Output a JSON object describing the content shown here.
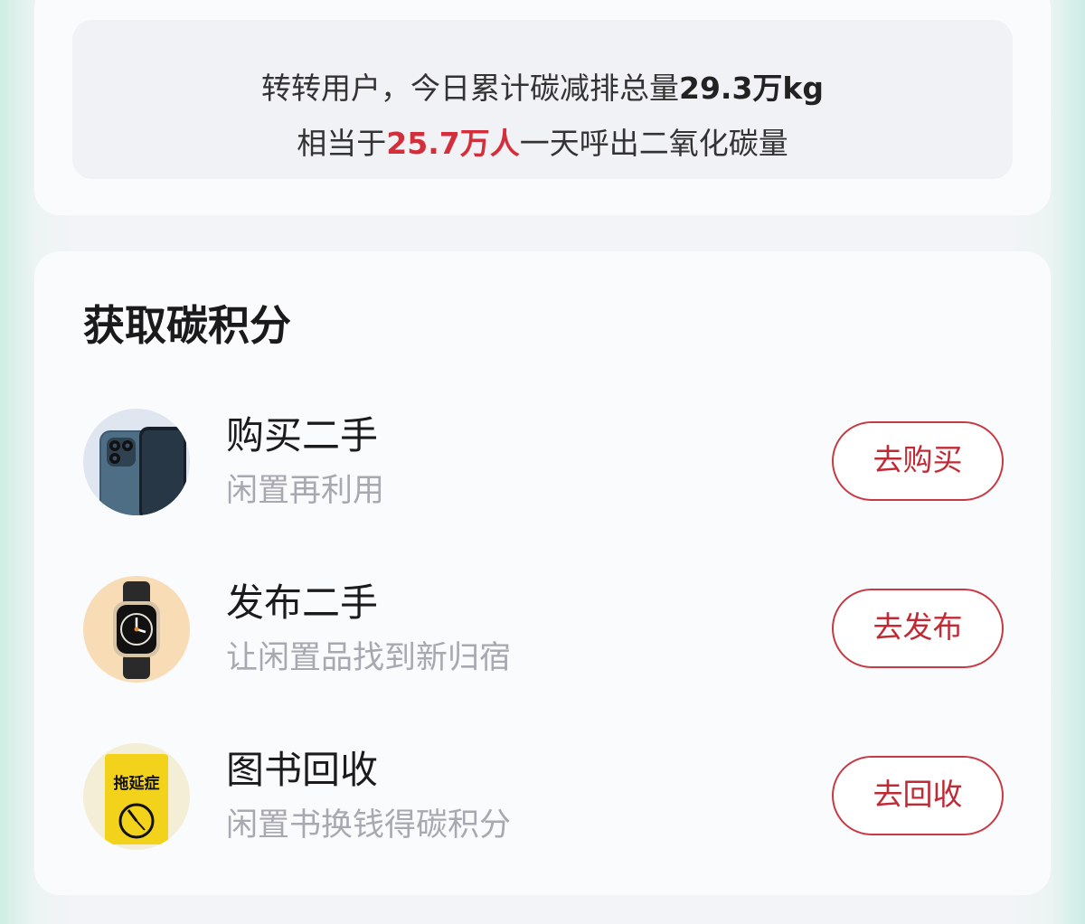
{
  "stats": {
    "line1_prefix": "转转用户，今日累计碳减排总量",
    "line1_value": "29.3万kg",
    "line2_prefix": "相当于",
    "line2_value": "25.7万人",
    "line2_suffix": "一天呼出二氧化碳量"
  },
  "section": {
    "title": "获取碳积分"
  },
  "items": [
    {
      "icon": "phone-icon",
      "title": "购买二手",
      "subtitle": "闲置再利用",
      "button": "去购买"
    },
    {
      "icon": "watch-icon",
      "title": "发布二手",
      "subtitle": "让闲置品找到新归宿",
      "button": "去发布"
    },
    {
      "icon": "book-icon",
      "title": "图书回收",
      "subtitle": "闲置书换钱得碳积分",
      "button": "去回收",
      "book_label": "拖延症"
    }
  ],
  "colors": {
    "accent": "#d32f3b",
    "button_border": "#c63a44",
    "background": "#f2f4f7"
  }
}
